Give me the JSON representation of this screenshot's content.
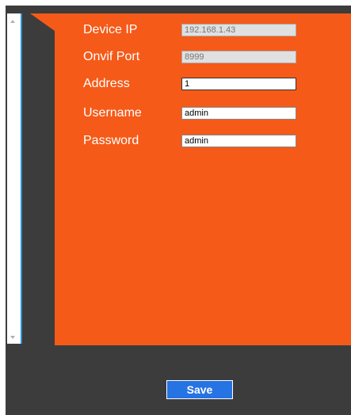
{
  "form": {
    "fields": [
      {
        "label": "Device IP",
        "value": "192.168.1.43",
        "readonly": true
      },
      {
        "label": "Onvif Port",
        "value": "8999",
        "readonly": true
      },
      {
        "label": "Address",
        "value": "1",
        "readonly": false,
        "focused": true
      },
      {
        "label": "Username",
        "value": "admin",
        "readonly": false
      },
      {
        "label": "Password",
        "value": "admin",
        "readonly": false
      }
    ]
  },
  "actions": {
    "save_label": "Save"
  },
  "colors": {
    "panel": "#f55a19",
    "background": "#3c3c3c",
    "save_button": "#2673e3",
    "scroll_accent": "#2c8fd6"
  }
}
